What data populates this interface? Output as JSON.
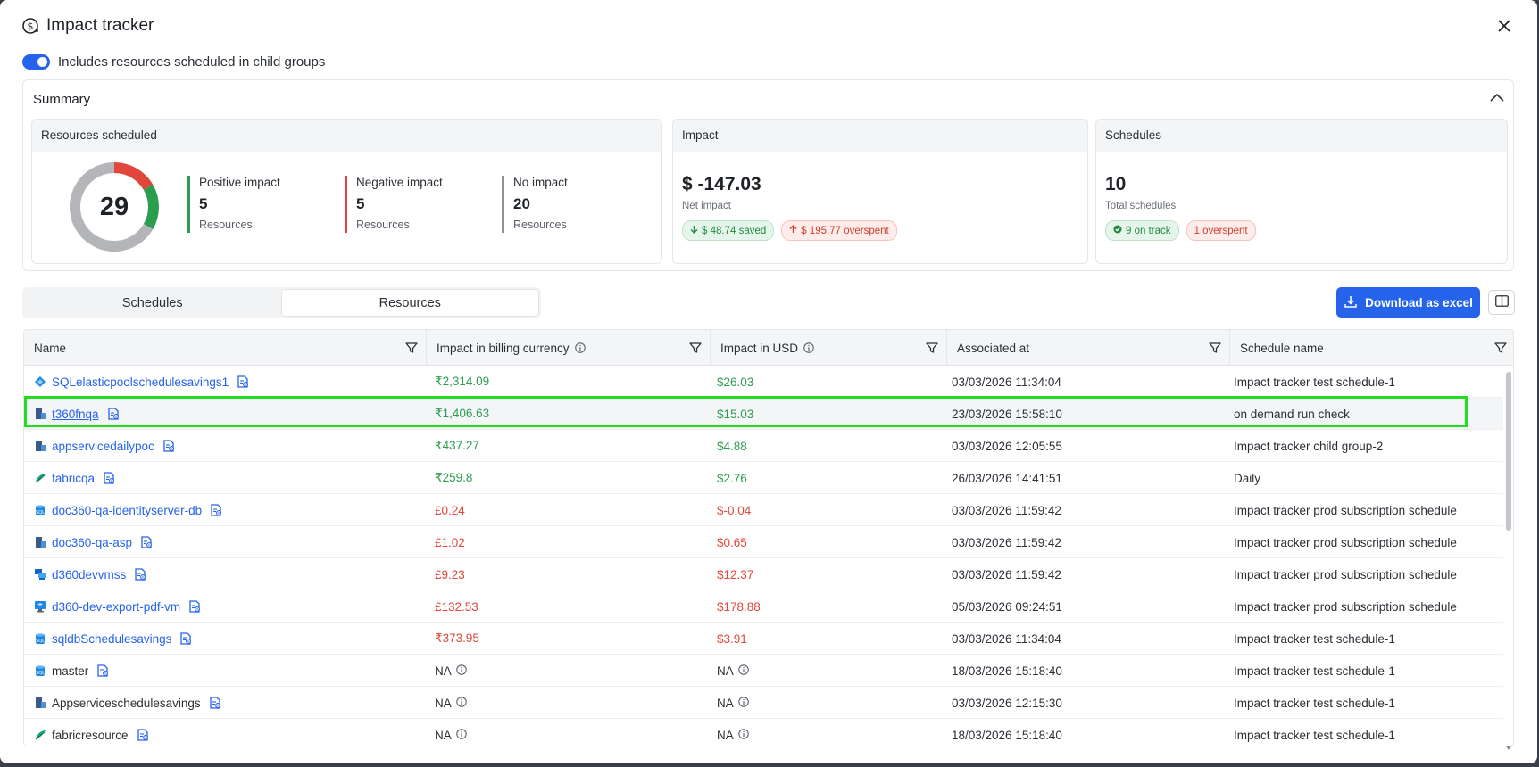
{
  "header": {
    "title": "Impact tracker",
    "title_icon": "dollar-cycle-icon",
    "close_icon": "close-icon"
  },
  "toggle": {
    "label": "Includes resources scheduled in child groups",
    "on": true
  },
  "summary": {
    "title": "Summary",
    "resources_card": {
      "title": "Resources scheduled",
      "total": "29",
      "donut": {
        "positive": 5,
        "negative": 5,
        "none": 20,
        "colors": {
          "positive": "#2a9d4f",
          "negative": "#e0473a",
          "none": "#b3b5b8"
        }
      },
      "positive": {
        "label": "Positive impact",
        "value": "5",
        "sub": "Resources"
      },
      "negative": {
        "label": "Negative impact",
        "value": "5",
        "sub": "Resources"
      },
      "none": {
        "label": "No impact",
        "value": "20",
        "sub": "Resources"
      }
    },
    "impact_card": {
      "title": "Impact",
      "value": "$ -147.03",
      "sub": "Net impact",
      "saved": "$ 48.74 saved",
      "overspent": "$ 195.77 overspent"
    },
    "schedules_card": {
      "title": "Schedules",
      "value": "10",
      "sub": "Total schedules",
      "on_track": "9 on track",
      "overspent": "1 overspent"
    }
  },
  "tabs": [
    {
      "label": "Schedules",
      "active": false
    },
    {
      "label": "Resources",
      "active": true
    }
  ],
  "download_label": "Download as excel",
  "table": {
    "columns": [
      "Name",
      "Impact in billing currency",
      "Impact in USD",
      "Associated at",
      "Schedule name"
    ],
    "rows": [
      {
        "name": "SQLelasticpoolschedulesavings1",
        "icon": "sql-elastic-pool-icon",
        "billing": "₹2,314.09",
        "usd": "$26.03",
        "associated": "03/03/2026 11:34:04",
        "schedule": "Impact tracker test schedule-1",
        "tone": "pos"
      },
      {
        "name": "t360fnqa",
        "icon": "app-service-icon",
        "billing": "₹1,406.63",
        "usd": "$15.03",
        "associated": "23/03/2026 15:58:10",
        "schedule": "on demand run check",
        "tone": "pos"
      },
      {
        "name": "appservicedailypoc",
        "icon": "app-service-icon",
        "billing": "₹437.27",
        "usd": "$4.88",
        "associated": "03/03/2026 12:05:55",
        "schedule": "Impact tracker child group-2",
        "tone": "pos"
      },
      {
        "name": "fabricqa",
        "icon": "fabric-icon",
        "billing": "₹259.8",
        "usd": "$2.76",
        "associated": "26/03/2026 14:41:51",
        "schedule": "Daily",
        "tone": "pos"
      },
      {
        "name": "doc360-qa-identityserver-db",
        "icon": "sql-database-icon",
        "billing": "£0.24",
        "usd": "$-0.04",
        "associated": "03/03/2026 11:59:42",
        "schedule": "Impact tracker prod subscription schedule",
        "tone": "neg"
      },
      {
        "name": "doc360-qa-asp",
        "icon": "app-service-icon",
        "billing": "£1.02",
        "usd": "$0.65",
        "associated": "03/03/2026 11:59:42",
        "schedule": "Impact tracker prod subscription schedule",
        "tone": "neg"
      },
      {
        "name": "d360devvmss",
        "icon": "vm-scale-set-icon",
        "billing": "£9.23",
        "usd": "$12.37",
        "associated": "03/03/2026 11:59:42",
        "schedule": "Impact tracker prod subscription schedule",
        "tone": "neg"
      },
      {
        "name": "d360-dev-export-pdf-vm",
        "icon": "virtual-machine-icon",
        "billing": "£132.53",
        "usd": "$178.88",
        "associated": "05/03/2026 09:24:51",
        "schedule": "Impact tracker prod subscription schedule",
        "tone": "neg"
      },
      {
        "name": "sqldbSchedulesavings",
        "icon": "sql-database-icon",
        "billing": "₹373.95",
        "usd": "$3.91",
        "associated": "03/03/2026 11:34:04",
        "schedule": "Impact tracker test schedule-1",
        "tone": "neg"
      },
      {
        "name": "master",
        "icon": "sql-database-icon",
        "billing": "NA",
        "usd": "NA",
        "associated": "18/03/2026 15:18:40",
        "schedule": "Impact tracker test schedule-1",
        "tone": "na"
      },
      {
        "name": "Appserviceschedulesavings",
        "icon": "app-service-icon",
        "billing": "NA",
        "usd": "NA",
        "associated": "03/03/2026 12:15:30",
        "schedule": "Impact tracker test schedule-1",
        "tone": "na"
      },
      {
        "name": "fabricresource",
        "icon": "fabric-icon",
        "billing": "NA",
        "usd": "NA",
        "associated": "18/03/2026 15:18:40",
        "schedule": "Impact tracker test schedule-1",
        "tone": "na"
      }
    ]
  }
}
